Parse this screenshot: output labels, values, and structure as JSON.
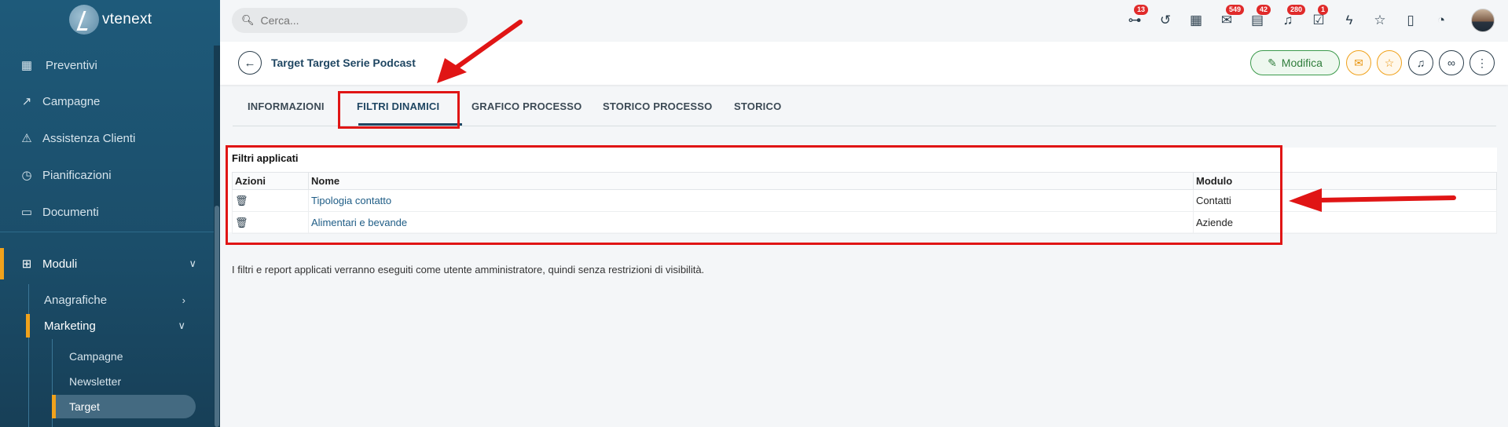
{
  "app": {
    "logo_text": "vtenext"
  },
  "sidebar": {
    "items": [
      {
        "label": "Preventivi",
        "icon": "calculator-icon"
      },
      {
        "label": "Campagne",
        "icon": "trend-icon"
      },
      {
        "label": "Assistenza Clienti",
        "icon": "warning-icon"
      },
      {
        "label": "Pianificazioni",
        "icon": "clock-icon"
      },
      {
        "label": "Documenti",
        "icon": "folder-icon"
      }
    ],
    "moduli": {
      "label": "Moduli",
      "icon": "grid-icon"
    },
    "sub_items": [
      {
        "label": "Anagrafiche"
      },
      {
        "label": "Marketing"
      }
    ],
    "marketing_items": [
      {
        "label": "Campagne"
      },
      {
        "label": "Newsletter"
      },
      {
        "label": "Target"
      }
    ]
  },
  "topbar": {
    "search_placeholder": "Cerca...",
    "icons": [
      {
        "name": "sitemap-icon",
        "badge": "13"
      },
      {
        "name": "history-icon",
        "badge": ""
      },
      {
        "name": "calendar-icon",
        "badge": ""
      },
      {
        "name": "mail-icon",
        "badge": "549"
      },
      {
        "name": "chat-icon",
        "badge": "42"
      },
      {
        "name": "bell-icon",
        "badge": "280"
      },
      {
        "name": "checkbox-icon",
        "badge": "1"
      },
      {
        "name": "bolt-icon",
        "badge": ""
      },
      {
        "name": "star-icon",
        "badge": ""
      },
      {
        "name": "document-icon",
        "badge": ""
      },
      {
        "name": "timer-icon",
        "badge": ""
      }
    ]
  },
  "header": {
    "title": "Target Target Serie Podcast",
    "edit_label": "Modifica"
  },
  "tabs": [
    {
      "label": "INFORMAZIONI"
    },
    {
      "label": "FILTRI DINAMICI"
    },
    {
      "label": "GRAFICO PROCESSO"
    },
    {
      "label": "STORICO PROCESSO"
    },
    {
      "label": "STORICO"
    }
  ],
  "filters": {
    "title": "Filtri applicati",
    "columns": {
      "azioni": "Azioni",
      "nome": "Nome",
      "modulo": "Modulo"
    },
    "rows": [
      {
        "nome": "Tipologia contatto",
        "modulo": "Contatti"
      },
      {
        "nome": "Alimentari e bevande",
        "modulo": "Aziende"
      }
    ]
  },
  "note": "I filtri e report applicati verranno eseguiti come utente amministratore, quindi senza restrizioni di visibilità.",
  "colors": {
    "sidebar": "#1e5a7a",
    "accent": "#f0a21c",
    "annotation": "#e01515",
    "edit_green": "#3c9a4c"
  }
}
